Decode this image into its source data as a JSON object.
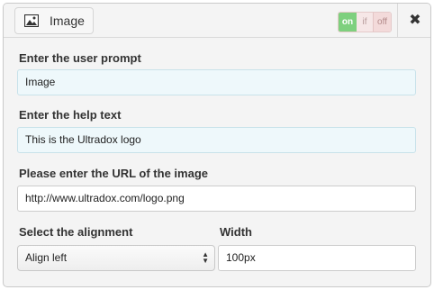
{
  "header": {
    "type_icon": "image-icon",
    "type_label": "Image",
    "toggle": {
      "on": "on",
      "if": "if",
      "off": "off"
    },
    "close_glyph": "✖"
  },
  "form": {
    "prompt": {
      "label": "Enter the user prompt",
      "value": "Image"
    },
    "help": {
      "label": "Enter the help text",
      "value": "This is the Ultradox logo"
    },
    "url": {
      "label": "Please enter the URL of the image",
      "value": "http://www.ultradox.com/logo.png"
    },
    "alignment": {
      "label": "Select the alignment",
      "value": "Align left"
    },
    "width": {
      "label": "Width",
      "value": "100px"
    }
  }
}
